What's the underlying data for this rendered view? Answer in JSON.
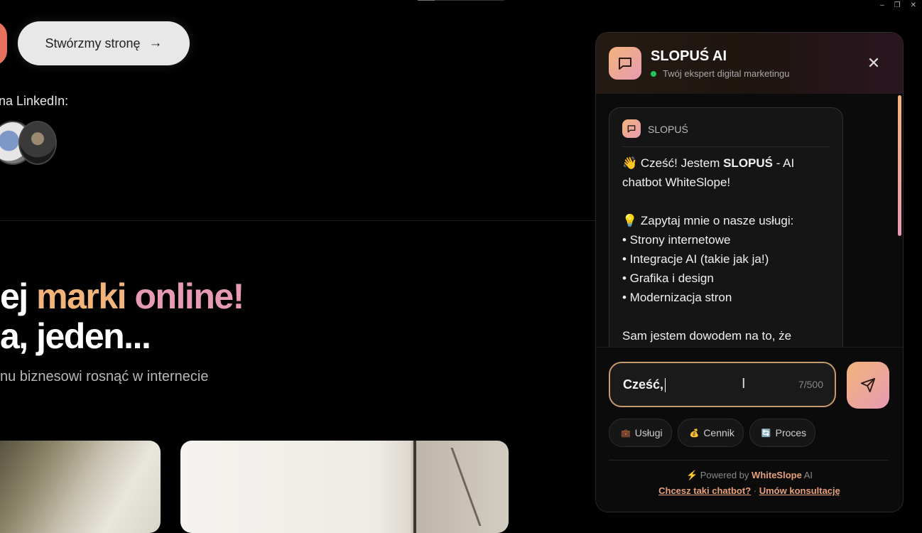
{
  "window": {
    "minimize": "–",
    "restore": "❐",
    "close": "✕"
  },
  "page": {
    "cta_label": "Stwórzmy stronę",
    "cta_arrow": "→",
    "linkedin_label": "na LinkedIn:",
    "hero_line1_w1": "ej",
    "hero_line1_w2": "marki",
    "hero_line1_w3": "online!",
    "hero_line2": "a, jeden...",
    "hero_sub": "nu biznesowi rosnąć w internecie"
  },
  "chat": {
    "title": "SLOPUŚ AI",
    "subtitle": "Twój ekspert digital marketingu",
    "close": "✕",
    "message": {
      "sender": "SLOPUŚ",
      "greeting_pre": "👋 Cześć! Jestem ",
      "greeting_bold": "SLOPUŚ",
      "greeting_post": " - AI chatbot WhiteSlope!",
      "ask": "💡 Zapytaj mnie o nasze usługi:",
      "items": [
        "• Strony internetowe",
        "• Integracje AI (takie jak ja!)",
        "• Grafika i design",
        "• Modernizacja stron"
      ],
      "cut": "Sam jestem dowodem na to, że"
    },
    "input_value": "Cześć,",
    "char_count": "7/500",
    "quick": [
      {
        "icon": "💼",
        "label": "Usługi"
      },
      {
        "icon": "💰",
        "label": "Cennik"
      },
      {
        "icon": "🔄",
        "label": "Proces"
      }
    ],
    "powered_icon": "⚡",
    "powered_pre": "Powered by",
    "powered_brand": "WhiteSlope",
    "powered_post": "AI",
    "link1": "Chcesz taki chatbot?",
    "sep": "·",
    "link2": "Umów konsultację"
  },
  "colors": {
    "accent_start": "#f2b47a",
    "accent_end": "#e79bb3",
    "online": "#22c55e"
  }
}
